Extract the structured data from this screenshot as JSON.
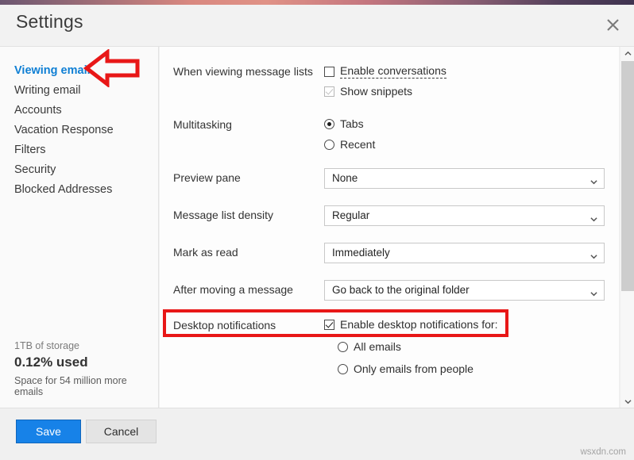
{
  "window": {
    "title": "Settings",
    "close_icon": "close-x-icon"
  },
  "sidebar": {
    "items": [
      {
        "label": "Viewing email",
        "active": true
      },
      {
        "label": "Writing email",
        "active": false
      },
      {
        "label": "Accounts",
        "active": false
      },
      {
        "label": "Vacation Response",
        "active": false
      },
      {
        "label": "Filters",
        "active": false
      },
      {
        "label": "Security",
        "active": false
      },
      {
        "label": "Blocked Addresses",
        "active": false
      }
    ],
    "storage": {
      "total": "1TB of storage",
      "used": "0.12% used",
      "note": "Space for 54 million more emails"
    }
  },
  "settings": {
    "rows": [
      {
        "label": "When viewing message lists",
        "options": [
          {
            "type": "checkbox",
            "label": "Enable conversations",
            "checked": false,
            "focused": true
          },
          {
            "type": "checkbox",
            "label": "Show snippets",
            "checked": true,
            "dim": true
          }
        ]
      },
      {
        "label": "Multitasking",
        "options": [
          {
            "type": "radio",
            "label": "Tabs",
            "selected": true
          },
          {
            "type": "radio",
            "label": "Recent",
            "selected": false
          }
        ]
      },
      {
        "label": "Preview pane",
        "select_value": "None"
      },
      {
        "label": "Message list density",
        "select_value": "Regular"
      },
      {
        "label": "Mark as read",
        "select_value": "Immediately"
      },
      {
        "label": "After moving a message",
        "select_value": "Go back to the original folder"
      },
      {
        "label": "Desktop notifications",
        "options": [
          {
            "type": "checkbox",
            "label": "Enable desktop notifications for:",
            "checked": true
          },
          {
            "type": "radio",
            "label": "All emails",
            "selected": false
          },
          {
            "type": "radio",
            "label": "Only emails from people",
            "selected": false
          }
        ]
      }
    ]
  },
  "footer": {
    "save_label": "Save",
    "cancel_label": "Cancel",
    "watermark": "wsxdn.com"
  },
  "annotations": {
    "arrow_color": "#e81717",
    "highlight_color": "#e81717"
  },
  "colors": {
    "accent_blue": "#0f7fd4",
    "save_blue": "#1782e8",
    "annotation_red": "#e81717"
  },
  "scrollbar": {
    "up_icon": "chevron-up-icon",
    "down_icon": "chevron-down-icon"
  }
}
